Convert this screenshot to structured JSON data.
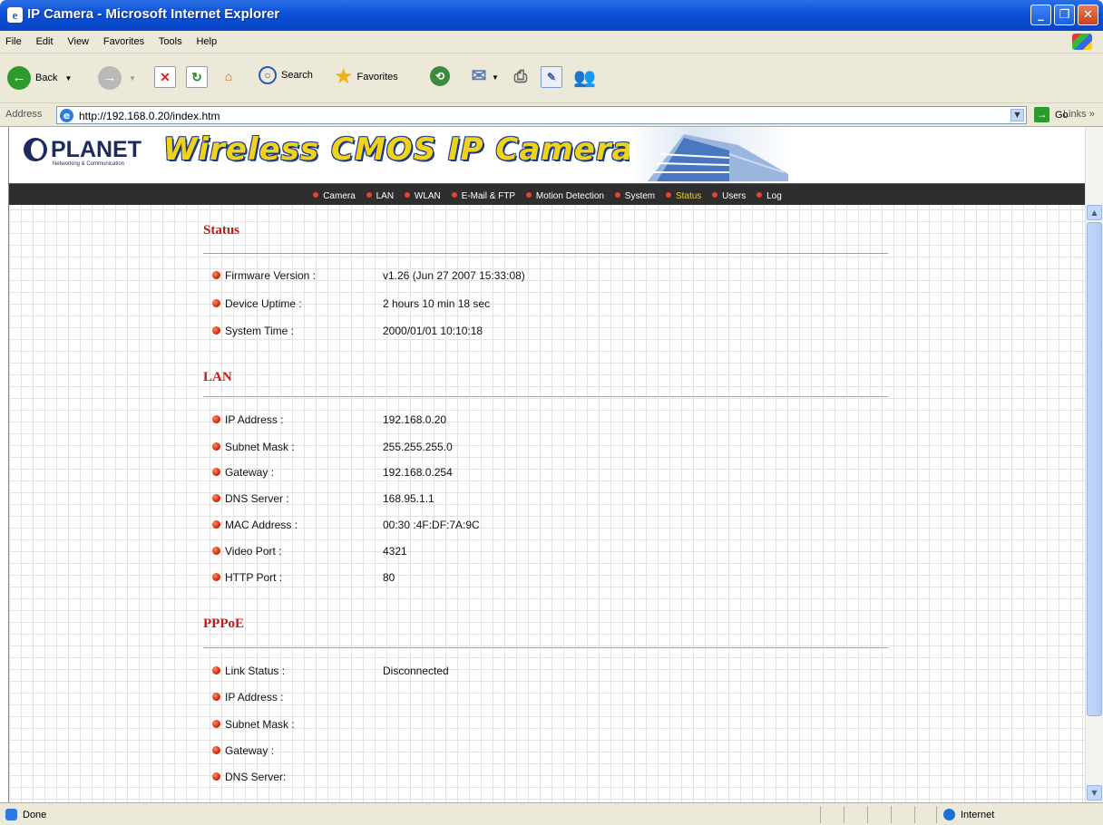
{
  "window": {
    "title": "IP Camera - Microsoft Internet Explorer"
  },
  "menu": {
    "items": [
      "File",
      "Edit",
      "View",
      "Favorites",
      "Tools",
      "Help"
    ]
  },
  "toolbar": {
    "back": "Back",
    "search": "Search",
    "favorites": "Favorites"
  },
  "address": {
    "label": "Address",
    "url": "http://192.168.0.20/index.htm",
    "go": "Go",
    "links": "Links"
  },
  "banner": {
    "logo_text": "PLANET",
    "logo_sub": "Networking & Communication",
    "title": "Wireless CMOS IP Camera"
  },
  "nav": {
    "items": [
      "Camera",
      "LAN",
      "WLAN",
      "E-Mail & FTP",
      "Motion Detection",
      "System",
      "Status",
      "Users",
      "Log"
    ],
    "active": "Status"
  },
  "sections": [
    {
      "title": "Status",
      "rows": [
        {
          "label": "Firmware Version :",
          "value": "v1.26 (Jun 27 2007 15:33:08)"
        },
        {
          "label": "Device Uptime :",
          "value": "2 hours 10 min 18 sec"
        },
        {
          "label": "System Time :",
          "value": "2000/01/01 10:10:18"
        }
      ]
    },
    {
      "title": "LAN",
      "rows": [
        {
          "label": "IP Address :",
          "value": "192.168.0.20"
        },
        {
          "label": "Subnet Mask :",
          "value": "255.255.255.0"
        },
        {
          "label": "Gateway :",
          "value": "192.168.0.254"
        },
        {
          "label": "DNS Server :",
          "value": "168.95.1.1"
        },
        {
          "label": "MAC Address :",
          "value": "00:30 :4F:DF:7A:9C"
        },
        {
          "label": "Video Port :",
          "value": "4321"
        },
        {
          "label": "HTTP Port :",
          "value": "80"
        }
      ]
    },
    {
      "title": "PPPoE",
      "rows": [
        {
          "label": "Link Status :",
          "value": "Disconnected"
        },
        {
          "label": "IP Address :",
          "value": ""
        },
        {
          "label": "Subnet Mask :",
          "value": ""
        },
        {
          "label": "Gateway :",
          "value": ""
        },
        {
          "label": "DNS Server:",
          "value": ""
        }
      ]
    }
  ],
  "status": {
    "text": "Done",
    "zone": "Internet"
  }
}
